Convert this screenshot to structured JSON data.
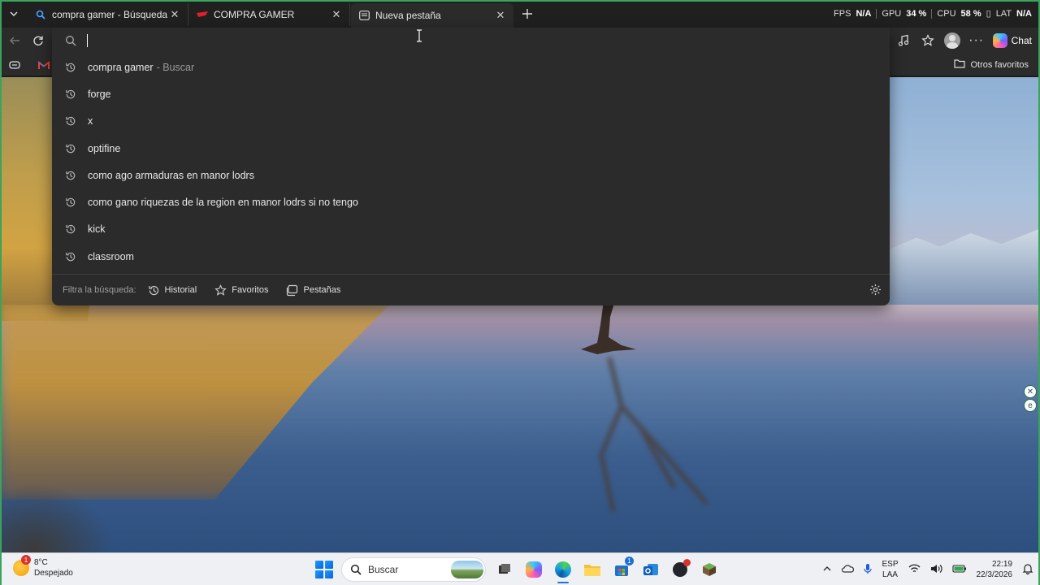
{
  "tabs": [
    {
      "title": "compra gamer - Búsqueda",
      "favicon": "search-icon",
      "active": false
    },
    {
      "title": "COMPRA GAMER",
      "favicon": "compragamer-logo-icon",
      "active": false
    },
    {
      "title": "Nueva pestaña",
      "favicon": "newtab-page-icon",
      "active": true
    }
  ],
  "perf": {
    "fps_label": "FPS",
    "fps_value": "N/A",
    "gpu_label": "GPU",
    "gpu_value": "34 %",
    "cpu_label": "CPU",
    "cpu_value": "58 %",
    "lat_label": "LAT",
    "lat_value": "N/A"
  },
  "toolbar": {
    "chat_label": "Chat"
  },
  "favorites_bar": {
    "other_favorites": "Otros favoritos"
  },
  "omnibox": {
    "input_value": "",
    "suggestions": [
      {
        "text": "compra gamer",
        "hint": "- Buscar"
      },
      {
        "text": "forge",
        "hint": ""
      },
      {
        "text": "x",
        "hint": ""
      },
      {
        "text": "optifine",
        "hint": ""
      },
      {
        "text": "como ago armaduras en manor lodrs",
        "hint": ""
      },
      {
        "text": "como gano riquezas de la region en manor lodrs si no tengo",
        "hint": ""
      },
      {
        "text": "kick",
        "hint": ""
      },
      {
        "text": "classroom",
        "hint": ""
      }
    ],
    "filter_label": "Filtra la búsqueda:",
    "filters": [
      "Historial",
      "Favoritos",
      "Pestañas"
    ]
  },
  "taskbar": {
    "weather_temp": "8°C",
    "weather_desc": "Despejado",
    "weather_badge": "1",
    "search_placeholder": "Buscar",
    "lang_top": "ESP",
    "lang_bottom": "LAA",
    "time": "22:19",
    "date": "22/3/2026",
    "store_badge": "1"
  },
  "colors": {
    "accent_green": "#3aa35c",
    "browser_dark": "#2b2b2b"
  }
}
